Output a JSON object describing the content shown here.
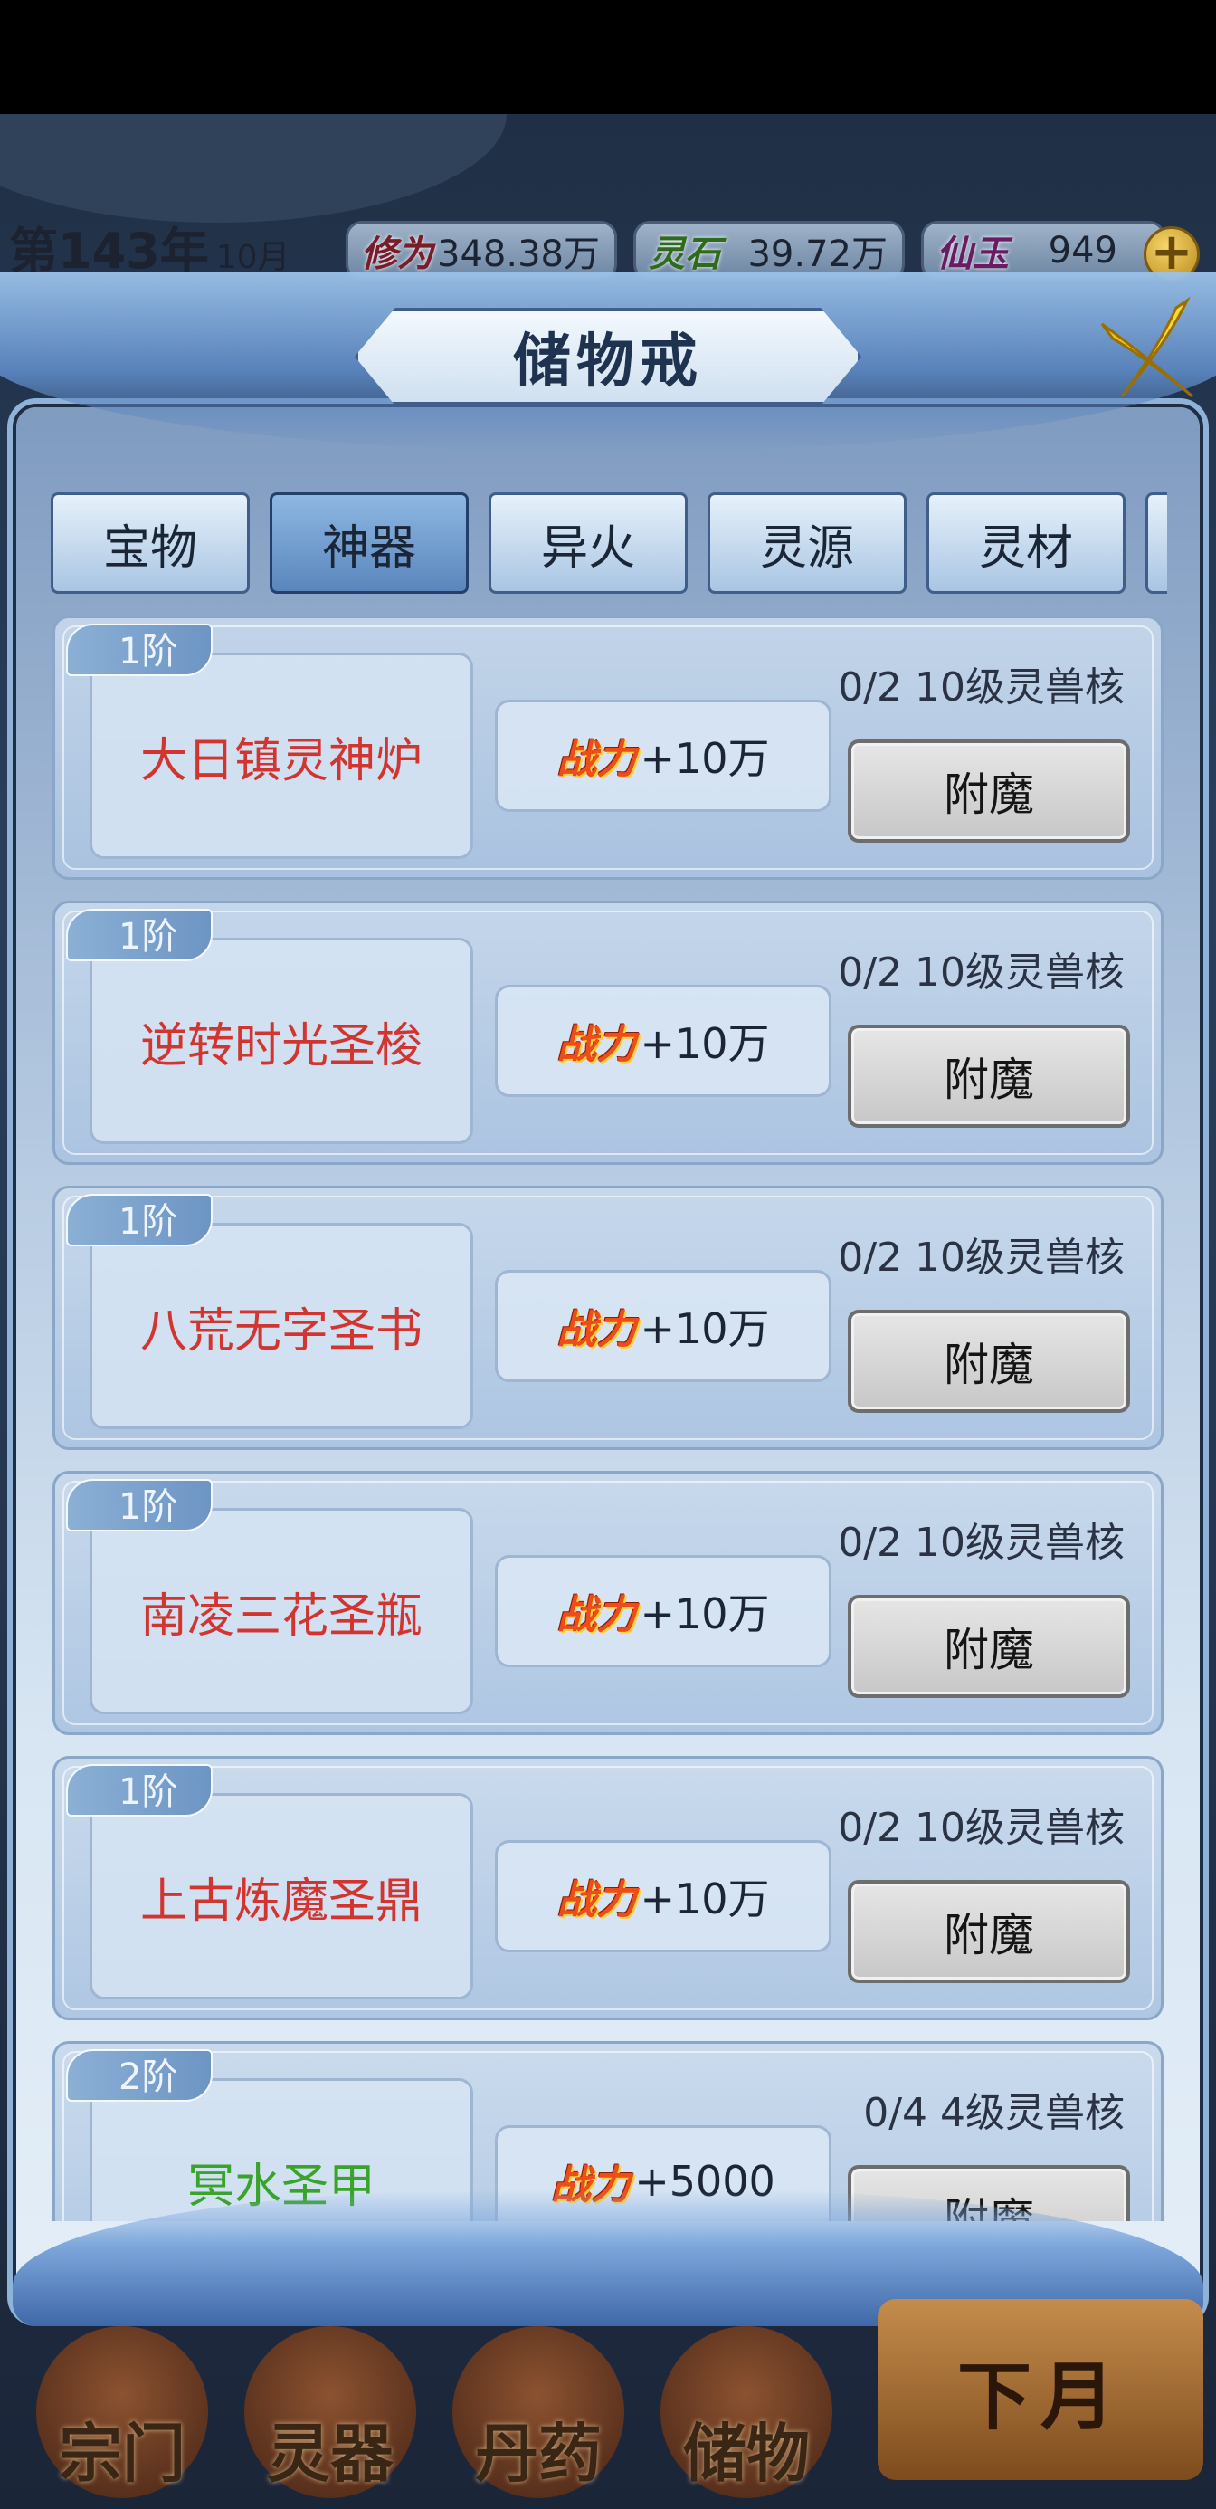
{
  "hud": {
    "year": "第143年",
    "month": "10月",
    "resources": [
      {
        "label": "修为",
        "value": "348.38万",
        "color": "#7a1d2a"
      },
      {
        "label": "灵石",
        "value": "39.72万",
        "color": "#2f6b1d"
      },
      {
        "label": "仙玉",
        "value": "949",
        "color": "#6a1b63"
      }
    ],
    "plus_label": "+"
  },
  "panel": {
    "title": "储物戒"
  },
  "tabs": [
    {
      "label": "宝物",
      "active": false
    },
    {
      "label": "神器",
      "active": true
    },
    {
      "label": "异火",
      "active": false
    },
    {
      "label": "灵源",
      "active": false
    },
    {
      "label": "灵材",
      "active": false
    }
  ],
  "power_icon_label": "战力",
  "enchant_label": "附魔",
  "items": [
    {
      "tier": "1阶",
      "name": "大日镇灵神炉",
      "name_color": "#d2352f",
      "power": "+10万",
      "requirement": "0/2 10级灵兽核"
    },
    {
      "tier": "1阶",
      "name": "逆转时光圣梭",
      "name_color": "#d2352f",
      "power": "+10万",
      "requirement": "0/2 10级灵兽核"
    },
    {
      "tier": "1阶",
      "name": "八荒无字圣书",
      "name_color": "#d2352f",
      "power": "+10万",
      "requirement": "0/2 10级灵兽核"
    },
    {
      "tier": "1阶",
      "name": "南凌三花圣瓶",
      "name_color": "#d2352f",
      "power": "+10万",
      "requirement": "0/2 10级灵兽核"
    },
    {
      "tier": "1阶",
      "name": "上古炼魔圣鼎",
      "name_color": "#d2352f",
      "power": "+10万",
      "requirement": "0/2 10级灵兽核"
    },
    {
      "tier": "2阶",
      "name": "冥水圣甲",
      "name_color": "#3aa32b",
      "power": "+5000",
      "requirement": "0/4 4级灵兽核"
    }
  ],
  "bottom_menu": [
    {
      "label": "宗门"
    },
    {
      "label": "灵器"
    },
    {
      "label": "丹药"
    },
    {
      "label": "储物"
    }
  ],
  "next_month_label": "下月"
}
